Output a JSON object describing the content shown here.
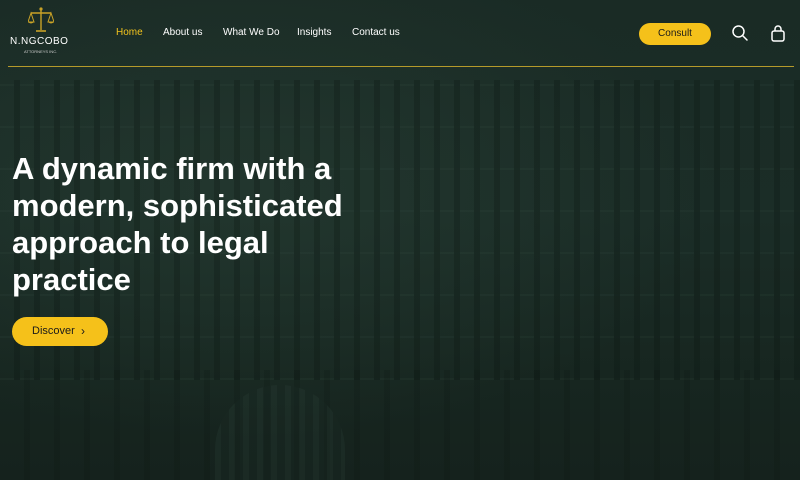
{
  "brand": {
    "name": "N.NGCOBO",
    "subtitle": "ATTORNEYS INC.",
    "logo_icon": "scales-of-justice-icon",
    "accent_color": "#f5c11a"
  },
  "nav": {
    "items": [
      {
        "label": "Home",
        "active": true
      },
      {
        "label": "About us",
        "active": false
      },
      {
        "label": "What We Do",
        "active": false
      },
      {
        "label": "Insights",
        "active": false
      },
      {
        "label": "Contact us",
        "active": false
      }
    ]
  },
  "header": {
    "consult_label": "Consult",
    "search_icon": "search-icon",
    "cart_icon": "shopping-bag-icon"
  },
  "hero": {
    "title": "A dynamic firm with a modern, sophisticated approach to legal practice",
    "cta_label": "Discover",
    "cta_icon": "chevron-right-icon"
  }
}
